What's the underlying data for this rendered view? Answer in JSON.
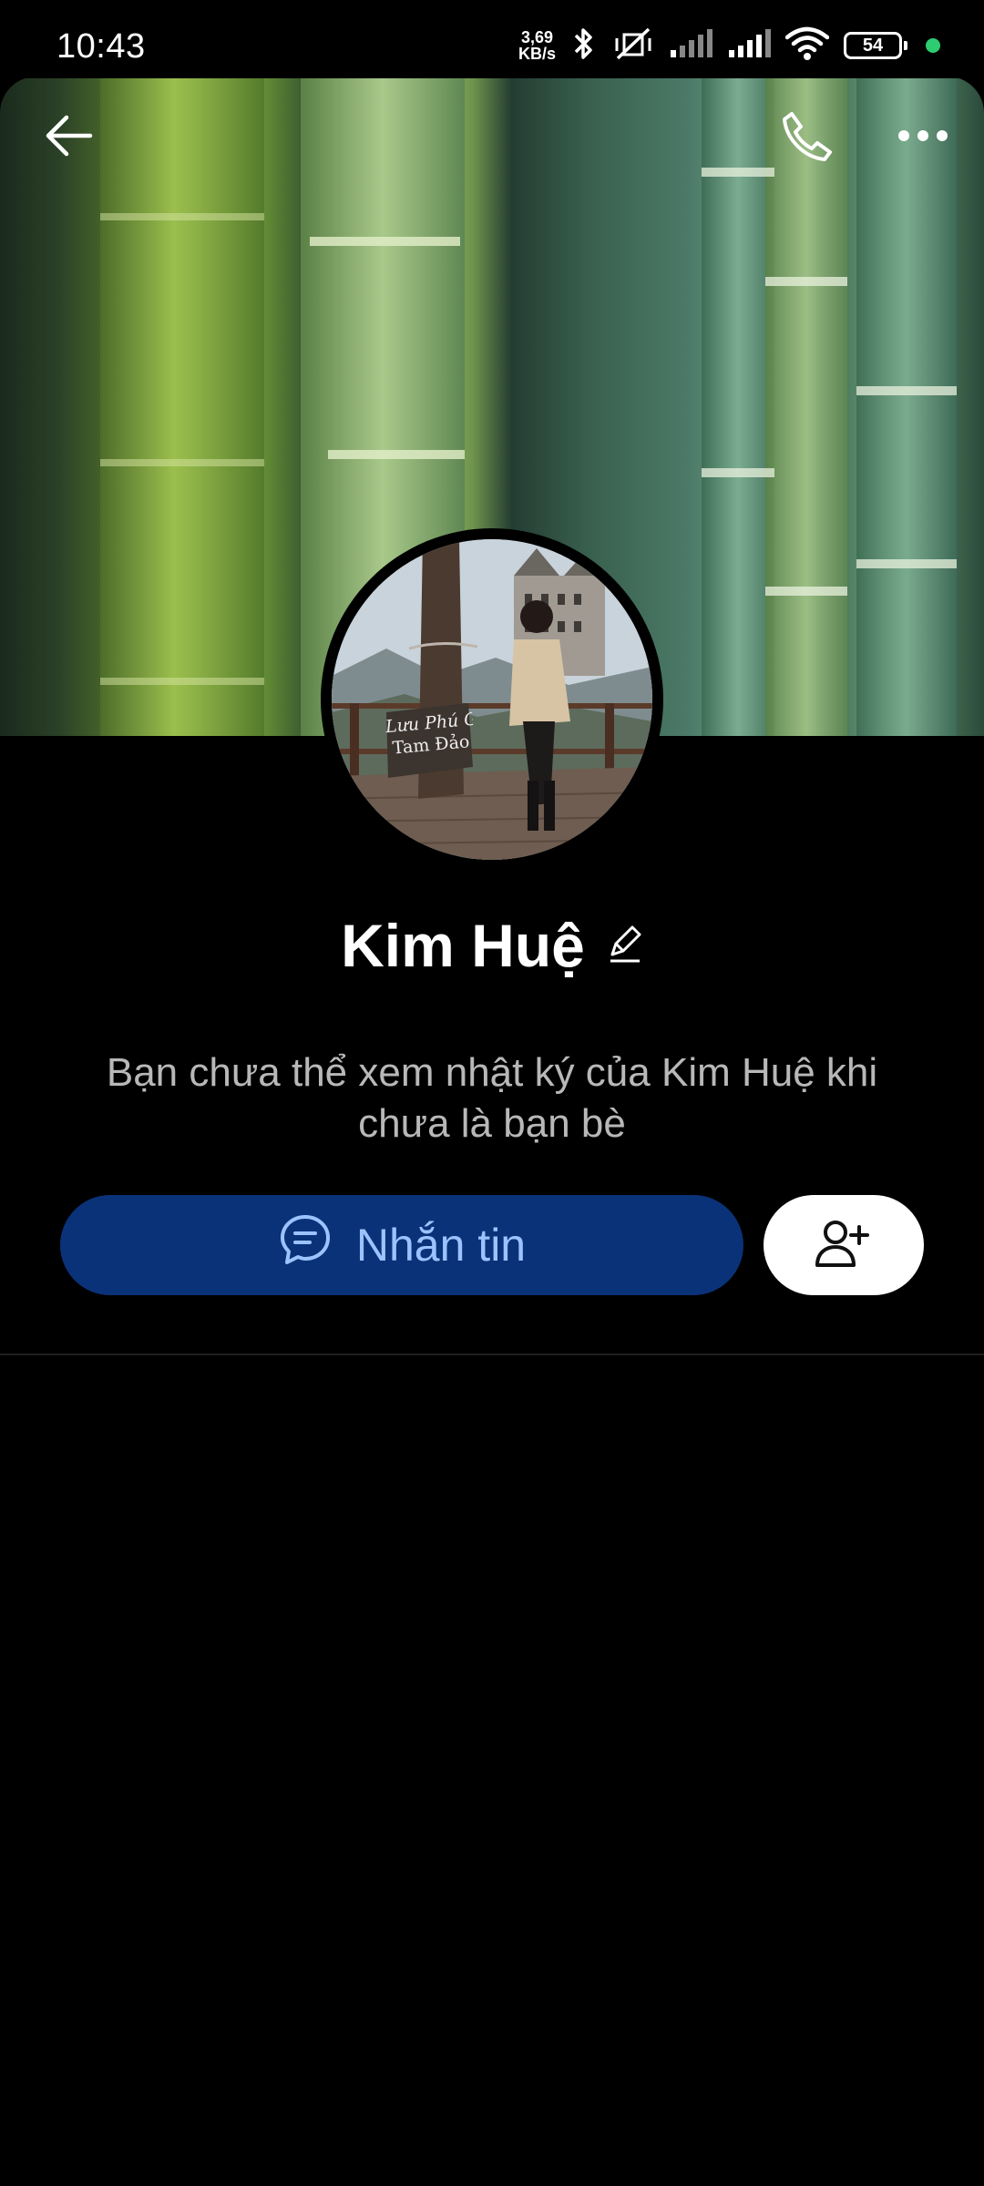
{
  "status_bar": {
    "time": "10:43",
    "net_speed_value": "3,69",
    "net_speed_unit": "KB/s",
    "battery": "54",
    "icons": [
      "bluetooth-icon",
      "mute-vibrate-icon",
      "signal-icon",
      "signal-icon",
      "wifi-icon",
      "battery-icon"
    ]
  },
  "header": {
    "icons": [
      "back-arrow-icon",
      "phone-icon",
      "more-dots-icon"
    ]
  },
  "profile": {
    "name": "Kim Huệ",
    "avatar_sign_line1": "Lưu Phú G",
    "avatar_sign_line2": "Tam Đảo",
    "notice": "Bạn chưa thể xem nhật ký của Kim Huệ khi chưa là bạn bè"
  },
  "actions": {
    "message_label": "Nhắn tin",
    "message_icon": "chat-bubble-icon",
    "add_friend_icon": "add-friend-icon"
  },
  "colors": {
    "background": "#000000",
    "message_button": "#0a3278",
    "message_text": "#9cc3ff",
    "add_friend_button": "#ffffff",
    "status_dot": "#2ecc71"
  }
}
